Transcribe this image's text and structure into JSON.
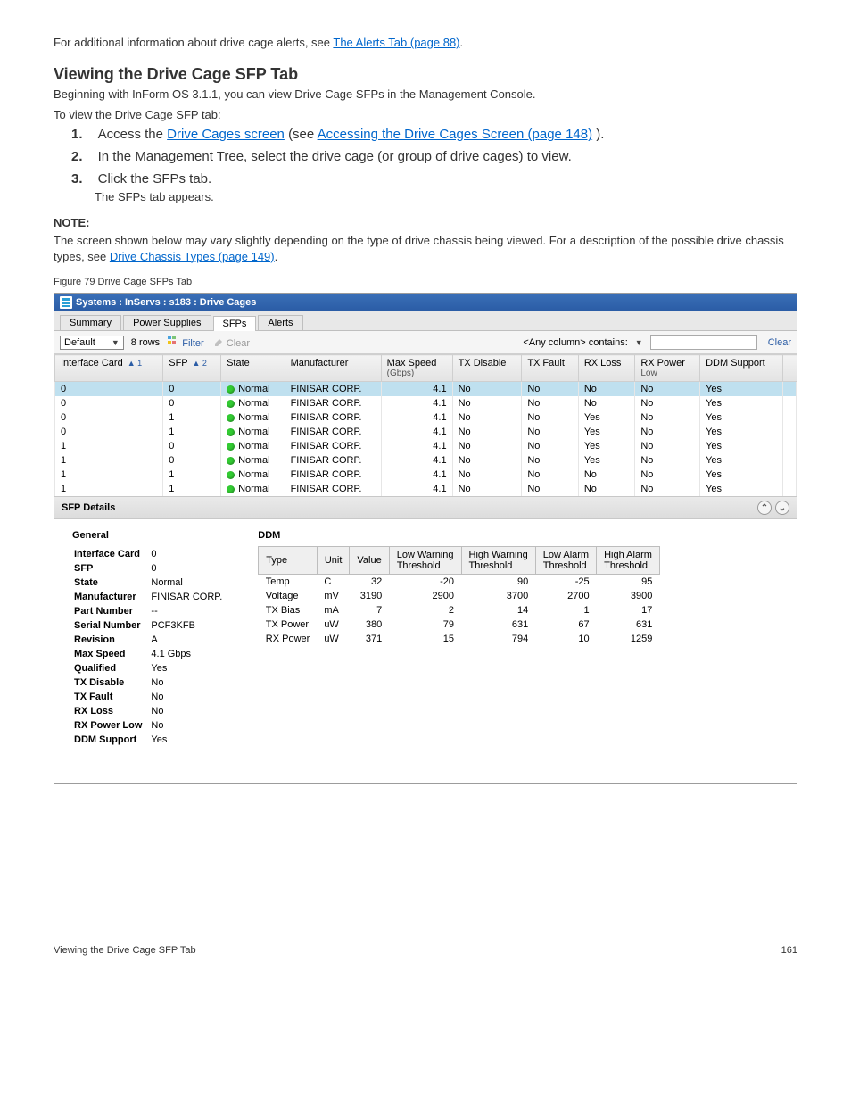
{
  "intro": {
    "lead_in": "For additional information about drive cage alerts, see ",
    "link1": "The Alerts Tab (page 88)",
    "period": "."
  },
  "h2": "Viewing the Drive Cage SFP Tab",
  "beginning_para": "Beginning with InForm OS 3.1.1, you can view Drive Cage SFPs in the Management Console.",
  "toview": "To view the Drive Cage SFP tab:",
  "steps": [
    {
      "num": "1.",
      "text_a": "Access the ",
      "link": "Drive Cages screen",
      "text_b": " (see ",
      "link2": "Accessing the Drive Cages Screen (page 148)",
      "text_c": ")."
    },
    {
      "num": "2.",
      "text": "In the Management Tree, select the drive cage (or group of drive cages) to view."
    },
    {
      "num": "3.",
      "text": "Click the SFPs tab."
    }
  ],
  "step3_sub": "The SFPs tab appears.",
  "note_head": "NOTE:",
  "note_body_a": "The screen shown below may vary slightly depending on the type of drive chassis being viewed. For a description of the possible drive chassis types, see ",
  "note_link": "Drive Chassis Types (page 149)",
  "note_body_b": ".",
  "fig_caption": "Figure 79 Drive Cage SFPs Tab",
  "app": {
    "title": "Systems : InServs : s183 : Drive Cages",
    "tabs": [
      "Summary",
      "Power Supplies",
      "SFPs",
      "Alerts"
    ],
    "active_tab_index": 2,
    "toolbar": {
      "view_select": "Default",
      "rows_label": "8 rows",
      "filter": "Filter",
      "clear": "Clear",
      "any_col": "<Any column> contains:",
      "right_clear": "Clear"
    },
    "columns": [
      {
        "label": "Interface Card",
        "sort": "▲ 1"
      },
      {
        "label": "SFP",
        "sort": "▲ 2"
      },
      {
        "label": "State"
      },
      {
        "label": "Manufacturer"
      },
      {
        "label": "Max Speed",
        "sub": "(Gbps)"
      },
      {
        "label": "TX Disable"
      },
      {
        "label": "TX Fault"
      },
      {
        "label": "RX Loss"
      },
      {
        "label": "RX Power",
        "sub": "Low"
      },
      {
        "label": "DDM Support"
      }
    ],
    "rows": [
      {
        "sel": true,
        "ic": "0",
        "sfp": "0",
        "state": "Normal",
        "mfr": "FINISAR CORP.",
        "speed": "4.1",
        "txd": "No",
        "txf": "No",
        "rxl": "No",
        "rxp": "No",
        "ddm": "Yes"
      },
      {
        "sel": false,
        "ic": "0",
        "sfp": "0",
        "state": "Normal",
        "mfr": "FINISAR CORP.",
        "speed": "4.1",
        "txd": "No",
        "txf": "No",
        "rxl": "No",
        "rxp": "No",
        "ddm": "Yes"
      },
      {
        "sel": false,
        "ic": "0",
        "sfp": "1",
        "state": "Normal",
        "mfr": "FINISAR CORP.",
        "speed": "4.1",
        "txd": "No",
        "txf": "No",
        "rxl": "Yes",
        "rxp": "No",
        "ddm": "Yes"
      },
      {
        "sel": false,
        "ic": "0",
        "sfp": "1",
        "state": "Normal",
        "mfr": "FINISAR CORP.",
        "speed": "4.1",
        "txd": "No",
        "txf": "No",
        "rxl": "Yes",
        "rxp": "No",
        "ddm": "Yes"
      },
      {
        "sel": false,
        "ic": "1",
        "sfp": "0",
        "state": "Normal",
        "mfr": "FINISAR CORP.",
        "speed": "4.1",
        "txd": "No",
        "txf": "No",
        "rxl": "Yes",
        "rxp": "No",
        "ddm": "Yes"
      },
      {
        "sel": false,
        "ic": "1",
        "sfp": "0",
        "state": "Normal",
        "mfr": "FINISAR CORP.",
        "speed": "4.1",
        "txd": "No",
        "txf": "No",
        "rxl": "Yes",
        "rxp": "No",
        "ddm": "Yes"
      },
      {
        "sel": false,
        "ic": "1",
        "sfp": "1",
        "state": "Normal",
        "mfr": "FINISAR CORP.",
        "speed": "4.1",
        "txd": "No",
        "txf": "No",
        "rxl": "No",
        "rxp": "No",
        "ddm": "Yes"
      },
      {
        "sel": false,
        "ic": "1",
        "sfp": "1",
        "state": "Normal",
        "mfr": "FINISAR CORP.",
        "speed": "4.1",
        "txd": "No",
        "txf": "No",
        "rxl": "No",
        "rxp": "No",
        "ddm": "Yes"
      }
    ],
    "details_title": "SFP Details",
    "general_title": "General",
    "general": [
      {
        "k": "Interface Card",
        "v": "0"
      },
      {
        "k": "SFP",
        "v": "0"
      },
      {
        "k": "State",
        "v": "Normal"
      },
      {
        "k": "Manufacturer",
        "v": "FINISAR CORP."
      },
      {
        "k": "Part Number",
        "v": "--"
      },
      {
        "k": "Serial Number",
        "v": "PCF3KFB"
      },
      {
        "k": "Revision",
        "v": "A"
      },
      {
        "k": "Max Speed",
        "v": "4.1 Gbps"
      },
      {
        "k": "Qualified",
        "v": "Yes"
      },
      {
        "k": "TX Disable",
        "v": "No"
      },
      {
        "k": "TX Fault",
        "v": "No"
      },
      {
        "k": "RX Loss",
        "v": "No"
      },
      {
        "k": "RX Power Low",
        "v": "No"
      },
      {
        "k": "DDM Support",
        "v": "Yes"
      }
    ],
    "ddm_title": "DDM",
    "ddm_cols": [
      "Type",
      "Unit",
      "Value",
      "Low Warning Threshold",
      "High Warning Threshold",
      "Low Alarm Threshold",
      "High Alarm Threshold"
    ],
    "ddm_rows": [
      {
        "t": "Temp",
        "u": "C",
        "v": "32",
        "lw": "-20",
        "hw": "90",
        "la": "-25",
        "ha": "95"
      },
      {
        "t": "Voltage",
        "u": "mV",
        "v": "3190",
        "lw": "2900",
        "hw": "3700",
        "la": "2700",
        "ha": "3900"
      },
      {
        "t": "TX Bias",
        "u": "mA",
        "v": "7",
        "lw": "2",
        "hw": "14",
        "la": "1",
        "ha": "17"
      },
      {
        "t": "TX Power",
        "u": "uW",
        "v": "380",
        "lw": "79",
        "hw": "631",
        "la": "67",
        "ha": "631"
      },
      {
        "t": "RX Power",
        "u": "uW",
        "v": "371",
        "lw": "15",
        "hw": "794",
        "la": "10",
        "ha": "1259"
      }
    ]
  },
  "footer_left": "Viewing the Drive Cage SFP Tab",
  "footer_right": "161"
}
